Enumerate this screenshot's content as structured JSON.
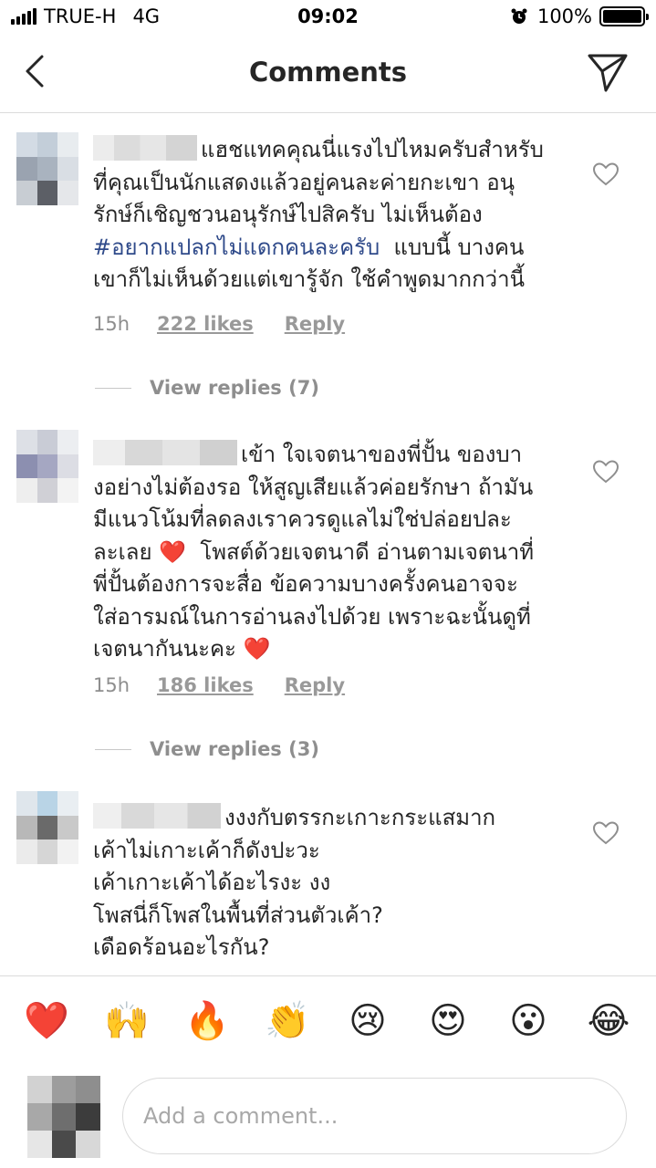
{
  "status_bar": {
    "carrier": "TRUE-H",
    "network": "4G",
    "time": "09:02",
    "battery": "100%"
  },
  "header": {
    "title": "Comments"
  },
  "comments": [
    {
      "text_parts": [
        {
          "text": "แฮชแทคคุณนี่แรงไปไหมครับสำหรับ\nที่คุณเป็นนักแสดงแล้วอยู่คนละค่ายกะเขา อนุ\nรักษ์ก็เชิญชวนอนุรักษ์ไปสิครับ ไม่เห็นต้อง\n"
        },
        {
          "text": "#อยากแปลกไม่แดกคนละครับ",
          "hashtag": true
        },
        {
          "text": "  แบบนี้ บางคน\nเขาก็ไม่เห็นด้วยแต่เขารู้จัก ใช้คำพูดมากกว่านี้"
        }
      ],
      "time": "15h",
      "likes": "222 likes",
      "reply": "Reply",
      "view_replies": "View replies (7)"
    },
    {
      "text_parts": [
        {
          "text": "เข้า ใจเจตนาของพี่ปั้น ของบา\nงอย่างไม่ต้องรอ ให้สูญเสียแล้วค่อยรักษา ถ้ามัน\nมีแนวโน้มที่ลดลงเราควรดูแลไม่ใช่ปล่อยปละ\nละเลย ❤️  โพสต์ด้วยเจตนาดี อ่านตามเจตนาที่\nพี่ปั้นต้องการจะสื่อ ข้อความบางครั้งคนอาจจะ\nใส่อารมณ์ในการอ่านลงไปด้วย เพราะฉะนั้นดูที่\nเจตนากันนะคะ ❤️"
        }
      ],
      "time": "15h",
      "likes": "186 likes",
      "reply": "Reply",
      "view_replies": "View replies (3)"
    },
    {
      "text_parts": [
        {
          "text": "งงงกับตรรกะเกาะกระแสมาก\nเค้าไม่เกาะเค้าก็ดังปะวะ\nเค้าเกาะเค้าได้อะไรงะ งง\nโพสนี่ก็โพสในพื้นที่ส่วนตัวเค้า?\nเดือดร้อนอะไรกัน?"
        }
      ]
    }
  ],
  "emoji_bar": [
    "❤️",
    "🙌",
    "🔥",
    "👏",
    "😢",
    "😍",
    "😮",
    "😂"
  ],
  "input": {
    "placeholder": "Add a comment..."
  },
  "colors": {
    "text": "#262626",
    "secondary": "#8e8e8e",
    "hashtag": "#2f4a8a",
    "divider": "#dbdbdb"
  }
}
